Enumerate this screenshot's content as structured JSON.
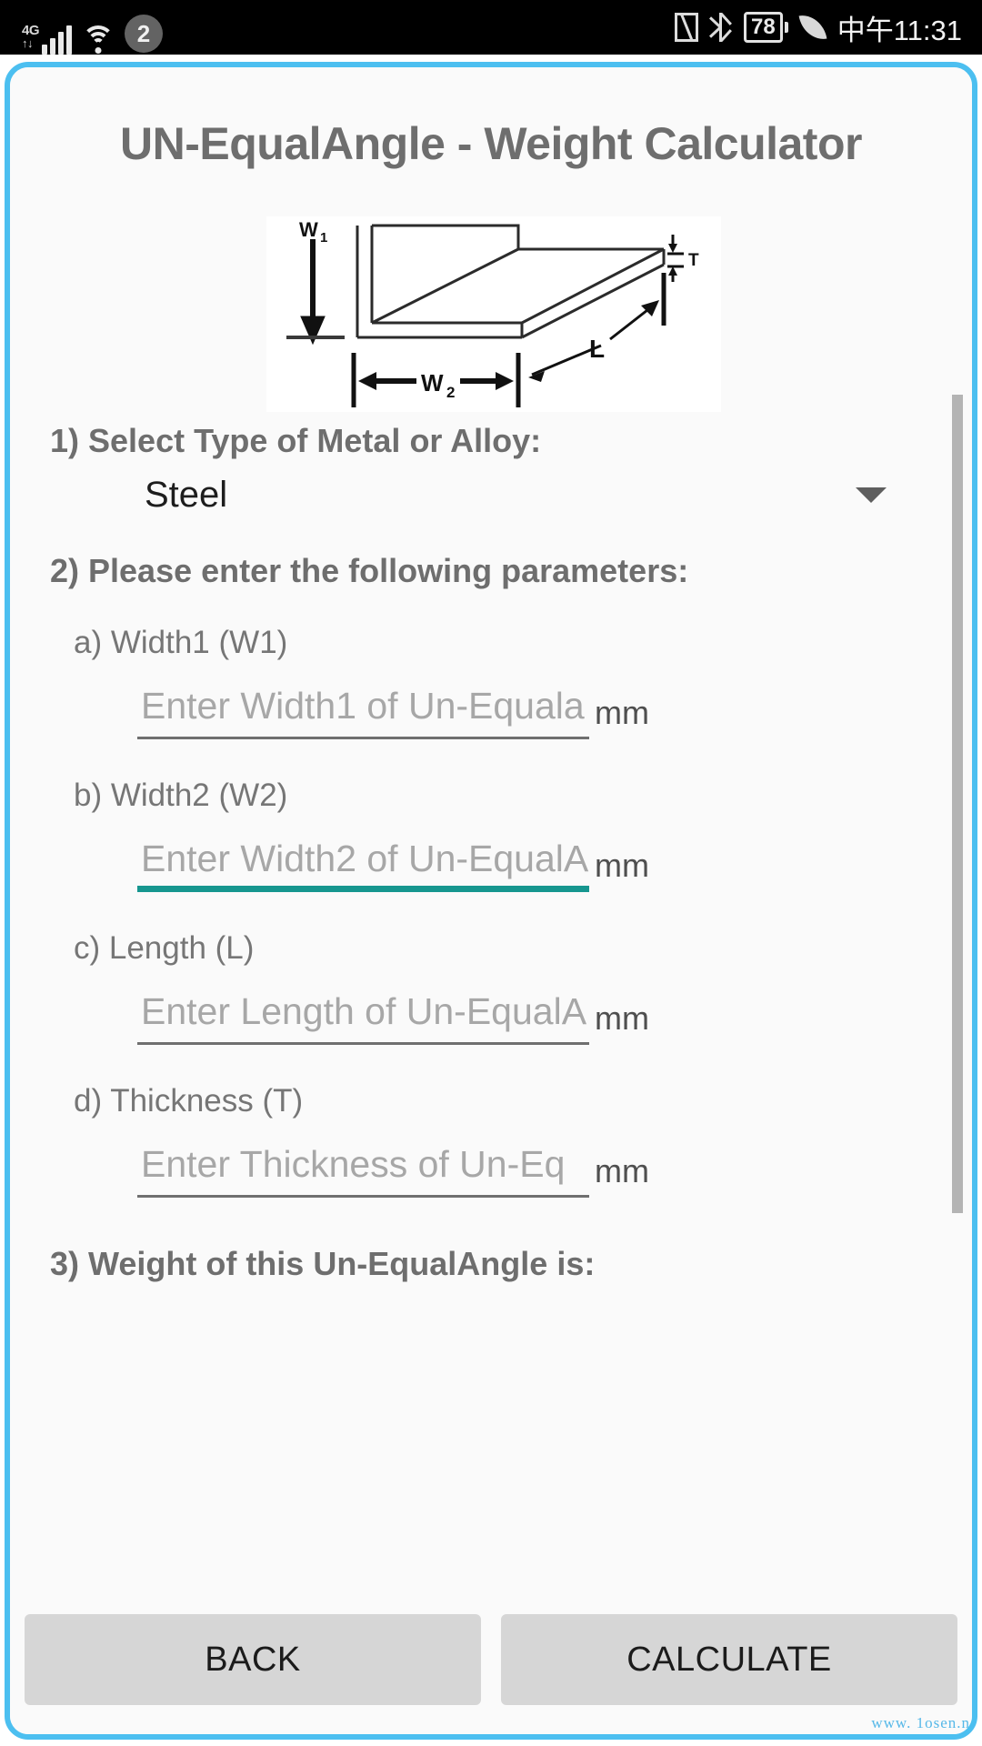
{
  "status_bar": {
    "network_type": "4G",
    "notification_count": "2",
    "battery_level": "78",
    "time": "中午11:31",
    "icons": [
      "signal-icon",
      "wifi-icon",
      "nfc-icon",
      "bluetooth-icon",
      "battery-icon",
      "leaf-icon"
    ]
  },
  "app": {
    "title": "UN-EqualAngle - Weight Calculator",
    "accent_border_color": "#4cbff0",
    "focus_color": "#16968f",
    "background_color": "#fafafa"
  },
  "diagram": {
    "alt": "Un-equal angle bar dimensions diagram",
    "labels": {
      "w1": "W",
      "w1_sub": "1",
      "w2": "W",
      "w2_sub": "2",
      "length": "L",
      "thickness": "T"
    }
  },
  "sections": {
    "select_metal": {
      "heading": "1) Select Type of Metal or Alloy:",
      "selected_value": "Steel"
    },
    "parameters": {
      "heading": "2) Please enter the following parameters:",
      "fields": [
        {
          "label": "a) Width1 (W1)",
          "placeholder": "Enter Width1 of Un-Equala",
          "value": "",
          "unit": "mm",
          "focused": false
        },
        {
          "label": "b) Width2 (W2)",
          "placeholder": "Enter Width2 of Un-EqualА",
          "value": "",
          "unit": "mm",
          "focused": true
        },
        {
          "label": "c) Length (L)",
          "placeholder": "Enter Length of Un-EqualА",
          "value": "",
          "unit": "mm",
          "focused": false
        },
        {
          "label": "d) Thickness (T)",
          "placeholder": "Enter Thickness of Un-Eq",
          "value": "",
          "unit": "mm",
          "focused": false
        }
      ]
    },
    "result": {
      "heading": "3) Weight of this Un-EqualAngle is:",
      "value": ""
    }
  },
  "buttons": {
    "back": "BACK",
    "calculate": "CALCULATE"
  },
  "watermark": "www. 1osen.n"
}
